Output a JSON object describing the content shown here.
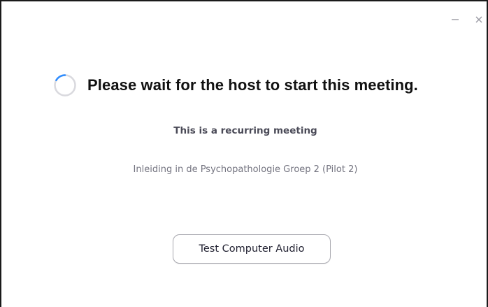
{
  "window": {
    "controls": [
      {
        "name": "minimize",
        "icon": "minimize-icon"
      },
      {
        "name": "close",
        "icon": "close-icon"
      }
    ]
  },
  "main": {
    "heading": "Please wait for the host to start this meeting.",
    "subheading": "This is a recurring meeting",
    "meeting_name": "Inleiding in de Psychopathologie Groep 2 (Pilot 2)",
    "test_audio_label": "Test Computer Audio",
    "spinner_icon": "loading-spinner-icon"
  },
  "colors": {
    "spinner_track": "#d9d9de",
    "spinner_arc": "#2d8cff",
    "heading": "#111111",
    "subheading": "#4a4a57",
    "meeting_name": "#747480"
  }
}
